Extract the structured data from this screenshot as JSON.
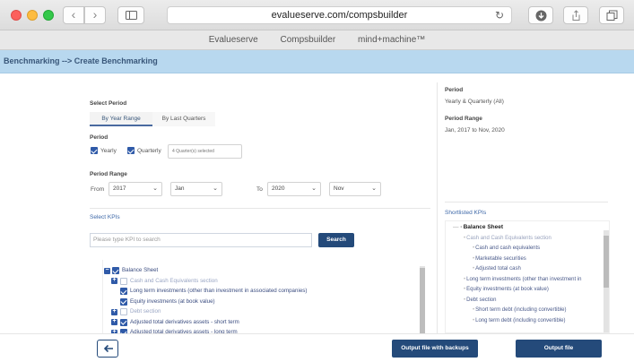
{
  "browser": {
    "url": "evalueserve.com/compsbuilder",
    "bookmarks": [
      "Evalueserve",
      "Compsbuilder",
      "mind+machine™"
    ]
  },
  "header": {
    "breadcrumb": "Benchmarking --> Create Benchmarking"
  },
  "left": {
    "select_period_label": "Select Period",
    "tabs": [
      {
        "label": "By Year Range",
        "active": true
      },
      {
        "label": "By Last Quarters",
        "active": false
      }
    ],
    "period_label": "Period",
    "period_options": [
      {
        "label": "Yearly",
        "checked": true
      },
      {
        "label": "Quarterly",
        "checked": true
      }
    ],
    "quarter_selector": "4 Quarter(s) selected",
    "period_range_label": "Period Range",
    "from_label": "From",
    "from_year": "2017",
    "from_month": "Jan",
    "to_label": "To",
    "to_year": "2020",
    "to_month": "Nov",
    "select_kpis_label": "Select KPIs",
    "search_placeholder": "Please type KPI to search",
    "search_button": "Search",
    "tree": [
      {
        "label": "Balance Sheet",
        "toggle": "-",
        "checked": true,
        "muted": false
      },
      {
        "label": "Cash and Cash Equivalents section",
        "toggle": "+",
        "checked": false,
        "muted": true
      },
      {
        "label": "Long term investments (other than investment in associated companies)",
        "toggle": "",
        "checked": true,
        "muted": false
      },
      {
        "label": "Equity investments (at book value)",
        "toggle": "",
        "checked": true,
        "muted": false
      },
      {
        "label": "Debt section",
        "toggle": "+",
        "checked": false,
        "muted": true
      },
      {
        "label": "Adjusted total derivatives assets - short term",
        "toggle": "+",
        "checked": true,
        "muted": false
      },
      {
        "label": "Adjusted total derivatives assets - long term",
        "toggle": "+",
        "checked": true,
        "muted": false
      }
    ]
  },
  "right": {
    "period_label": "Period",
    "period_value": "Yearly & Quarterly (All)",
    "period_range_label": "Period Range",
    "period_range_value": "Jan, 2017 to Nov, 2020",
    "shortlisted_label": "Shortlisted KPIs",
    "shortlist": [
      {
        "label": "Balance Sheet",
        "level": 0,
        "style": "bold"
      },
      {
        "label": "Cash and Cash Equivalents section",
        "level": 1,
        "style": "muted"
      },
      {
        "label": "Cash and cash equivalents",
        "level": 2,
        "style": "normal"
      },
      {
        "label": "Marketable securities",
        "level": 2,
        "style": "normal"
      },
      {
        "label": "Adjusted total cash",
        "level": 2,
        "style": "normal"
      },
      {
        "label": "Long term investments (other than investment in",
        "level": 1,
        "style": "normal"
      },
      {
        "label": "Equity investments (at book value)",
        "level": 1,
        "style": "normal"
      },
      {
        "label": "Debt section",
        "level": 1,
        "style": "normal"
      },
      {
        "label": "Short term debt (including convertible)",
        "level": 2,
        "style": "normal"
      },
      {
        "label": "Long term debt (including convertible)",
        "level": 2,
        "style": "normal"
      }
    ]
  },
  "footer": {
    "output_backups": "Output file with backups",
    "output_file": "Output file"
  },
  "colors": {
    "accent": "#244a7a",
    "header_band": "#b8d8ef",
    "checkbox": "#2f5aa8"
  }
}
